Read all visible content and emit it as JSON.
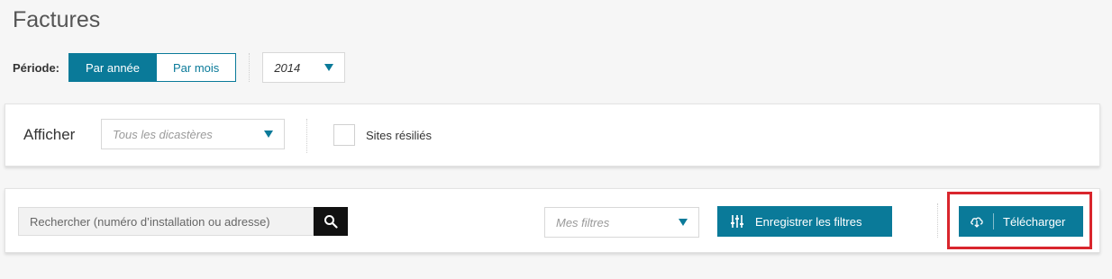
{
  "page": {
    "title": "Factures"
  },
  "period": {
    "label": "Période:",
    "options": [
      "Par année",
      "Par mois"
    ],
    "active_option": "Par année",
    "year": "2014"
  },
  "filters": {
    "label": "Afficher",
    "dicasteres_placeholder": "Tous les dicastères",
    "sites_label": "Sites résiliés",
    "sites_checked": false
  },
  "toolbar": {
    "search_placeholder": "Rechercher (numéro d’installation ou adresse)",
    "my_filters_placeholder": "Mes filtres",
    "save_filters_label": "Enregistrer les filtres",
    "download_label": "Télécharger"
  },
  "colors": {
    "accent": "#0a7a99",
    "highlight": "#d9262d",
    "search_button": "#111111"
  },
  "icons": {
    "search": "search-icon",
    "save_filters": "sliders-icon",
    "download": "cloud-download-icon",
    "dropdown": "caret-down-icon"
  }
}
